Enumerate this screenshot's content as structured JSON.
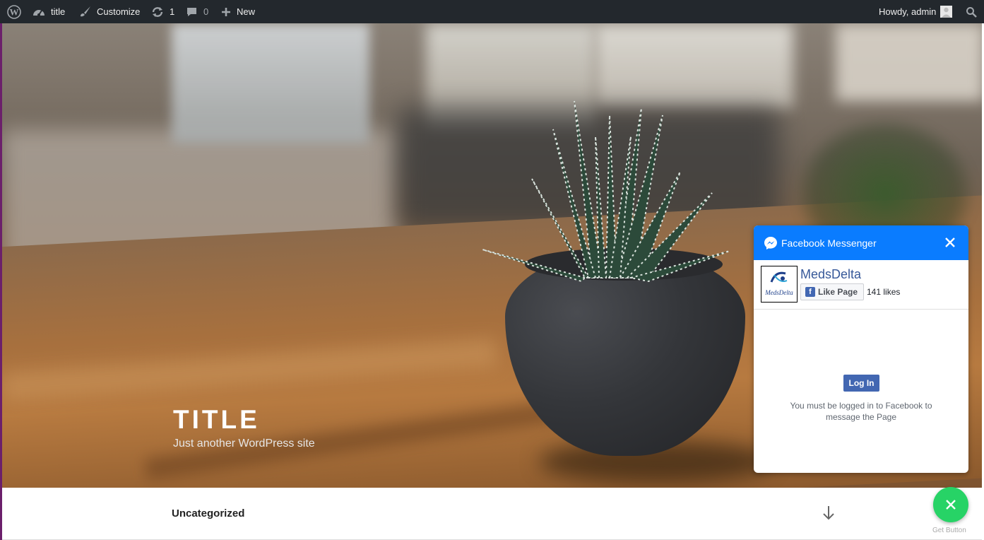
{
  "adminbar": {
    "site_name": "title",
    "customize_label": "Customize",
    "updates_count": "1",
    "comments_count": "0",
    "new_label": "New",
    "greeting": "Howdy, admin"
  },
  "hero": {
    "title": "TITLE",
    "tagline": "Just another WordPress site"
  },
  "navbar": {
    "category_label": "Uncategorized"
  },
  "messenger": {
    "header_title": "Facebook Messenger",
    "page_name": "MedsDelta",
    "avatar_text": "MedsDelta",
    "like_button_label": "Like Page",
    "likes_count": "141 likes",
    "login_button_label": "Log In",
    "login_message": "You must be logged in to Facebook to message the Page"
  },
  "get_button": {
    "label": "Get Button"
  },
  "colors": {
    "adminbar_bg": "#23282d",
    "messenger_blue": "#0a7cff",
    "facebook_blue": "#4267b2",
    "get_button_green": "#27d366"
  }
}
